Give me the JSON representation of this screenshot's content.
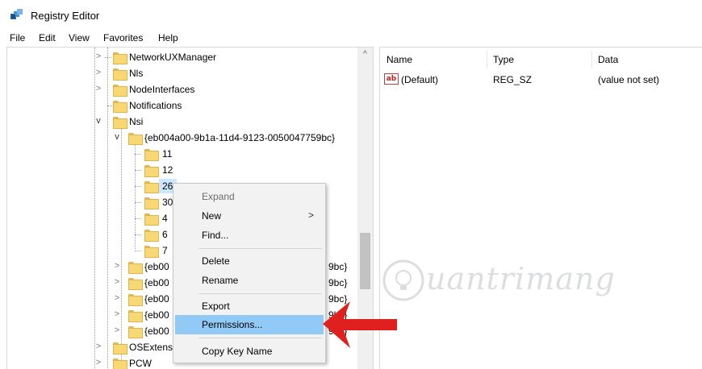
{
  "window": {
    "title": "Registry Editor"
  },
  "menubar": {
    "items": [
      "File",
      "Edit",
      "View",
      "Favorites",
      "Help"
    ]
  },
  "tree": {
    "items": [
      {
        "label": "NetworkUXManager",
        "expanded": false
      },
      {
        "label": "Nls",
        "expanded": false
      },
      {
        "label": "NodeInterfaces",
        "expanded": false
      },
      {
        "label": "Notifications",
        "expanded": false
      },
      {
        "label": "Nsi",
        "expanded": true
      },
      {
        "label": "{eb004a00-9b1a-11d4-9123-0050047759bc}",
        "expanded": true
      },
      {
        "label": "11"
      },
      {
        "label": "12"
      },
      {
        "label": "26",
        "selected": true
      },
      {
        "label": "30"
      },
      {
        "label": "4"
      },
      {
        "label": "6"
      },
      {
        "label": "7"
      },
      {
        "label": "{eb00",
        "suffix": "9bc}"
      },
      {
        "label": "{eb00",
        "suffix": "9bc}"
      },
      {
        "label": "{eb00",
        "suffix": "9bc}"
      },
      {
        "label": "{eb00",
        "suffix": "9bc}"
      },
      {
        "label": "{eb00",
        "suffix": "9bc}"
      },
      {
        "label": "OSExtens"
      },
      {
        "label": "PCW"
      }
    ]
  },
  "list": {
    "columns": [
      "Name",
      "Type",
      "Data"
    ],
    "rows": [
      {
        "name": "(Default)",
        "type": "REG_SZ",
        "data": "(value not set)",
        "icon": "ab"
      }
    ]
  },
  "context_menu": {
    "items": [
      {
        "label": "Expand",
        "disabled": true
      },
      {
        "label": "New",
        "submenu": true
      },
      {
        "label": "Find..."
      },
      {
        "label": "Delete"
      },
      {
        "label": "Rename"
      },
      {
        "label": "Export"
      },
      {
        "label": "Permissions...",
        "highlighted": true
      },
      {
        "label": "Copy Key Name"
      }
    ],
    "submenu_arrow": ">"
  },
  "watermark": {
    "text": "uantrimang"
  },
  "icons": {
    "tree_collapsed": ">",
    "tree_expanded": "v",
    "scroll_up": "^"
  },
  "colors": {
    "highlight": "#91c9f7",
    "selection": "#cce8ff",
    "folder": "#f8d775",
    "annotation_arrow": "#e0201f"
  }
}
